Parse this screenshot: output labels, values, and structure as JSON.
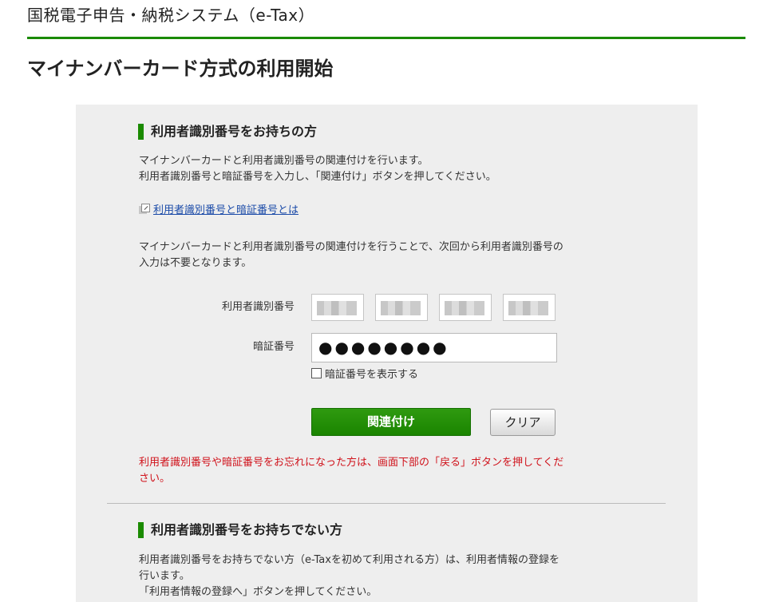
{
  "header": {
    "site_title": "国税電子申告・納税システム（e-Tax）"
  },
  "page_title": "マイナンバーカード方式の利用開始",
  "section_with_id": {
    "heading": "利用者識別番号をお持ちの方",
    "intro_line1": "マイナンバーカードと利用者識別番号の関連付けを行います。",
    "intro_line2": "利用者識別番号と暗証番号を入力し、「関連付け」ボタンを押してください。",
    "help_link": "利用者識別番号と暗証番号とは",
    "note_line1": "マイナンバーカードと利用者識別番号の関連付けを行うことで、次回から利用者識別番号の",
    "note_line2": "入力は不要となります。",
    "form": {
      "user_id_label": "利用者識別番号",
      "pin_label": "暗証番号",
      "pin_value": "●●●●●●●●",
      "show_pin_label": "暗証番号を表示する",
      "link_button": "関連付け",
      "clear_button": "クリア"
    },
    "warning_line1": "利用者識別番号や暗証番号をお忘れになった方は、画面下部の「戻る」ボタンを押してくだ",
    "warning_line2": "さい。"
  },
  "section_without_id": {
    "heading": "利用者識別番号をお持ちでない方",
    "line1": "利用者識別番号をお持ちでない方（e-Taxを初めて利用される方）は、利用者情報の登録を",
    "line2": "行います。",
    "line3": "「利用者情報の登録へ」ボタンを押してください。"
  },
  "colors": {
    "accent_green": "#1a8a00",
    "warning_red": "#d0121b",
    "link_blue": "#1a4aa8",
    "panel_gray": "#eeeeee"
  }
}
